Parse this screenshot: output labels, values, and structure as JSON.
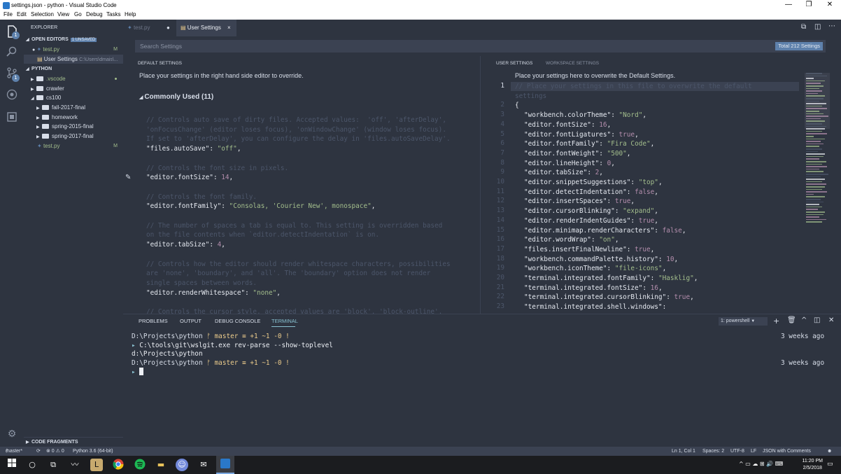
{
  "window": {
    "title": "settings.json - python - Visual Studio Code",
    "minimize": "—",
    "maximize": "❐",
    "close": "✕"
  },
  "menu": [
    "File",
    "Edit",
    "Selection",
    "View",
    "Go",
    "Debug",
    "Tasks",
    "Help"
  ],
  "activity": {
    "explorer_badge": "1",
    "scm_badge": "1"
  },
  "sidebar": {
    "title": "EXPLORER",
    "open_editors": {
      "label": "OPEN EDITORS",
      "unsaved": "1 UNSAVED",
      "items": [
        {
          "name": "test.py",
          "status": "M"
        },
        {
          "name": "User Settings",
          "path": "C:\\Users\\dmais\\..."
        }
      ]
    },
    "folder": "PYTHON",
    "tree": [
      ".vscode",
      "crawler",
      "cs100",
      "fall-2017-final",
      "homework",
      "spring-2015-final",
      "spring-2017-final",
      "test.py"
    ],
    "test_status": "M",
    "code_fragments": "CODE FRAGMENTS"
  },
  "tabs": [
    {
      "label": "test.py",
      "mark": "●"
    },
    {
      "label": "User Settings",
      "mark": "×"
    }
  ],
  "search": {
    "placeholder": "Search Settings",
    "total": "Total 212 Settings"
  },
  "default_settings": {
    "header": "DEFAULT SETTINGS",
    "hint": "Place your settings in the right hand side editor to override.",
    "section": "Commonly Used (11)",
    "blocks": [
      {
        "comments": [
          "// Controls auto save of dirty files. Accepted values:  'off', 'afterDelay',",
          "'onFocusChange' (editor loses focus), 'onWindowChange' (window loses focus).",
          "If set to 'afterDelay', you can configure the delay in 'files.autoSaveDelay'."
        ],
        "key": "\"files.autoSave\"",
        "value": "\"off\"",
        "vtype": "str"
      },
      {
        "comments": [
          "// Controls the font size in pixels."
        ],
        "key": "\"editor.fontSize\"",
        "value": "14",
        "vtype": "num"
      },
      {
        "comments": [
          "// Controls the font family."
        ],
        "key": "\"editor.fontFamily\"",
        "value": "\"Consolas, 'Courier New', monospace\"",
        "vtype": "str"
      },
      {
        "comments": [
          "// The number of spaces a tab is equal to. This setting is overridden based",
          "on the file contents when `editor.detectIndentation` is on."
        ],
        "key": "\"editor.tabSize\"",
        "value": "4",
        "vtype": "num"
      },
      {
        "comments": [
          "// Controls how the editor should render whitespace characters, possibilities",
          "are 'none', 'boundary', and 'all'. The 'boundary' option does not render",
          "single spaces between words."
        ],
        "key": "\"editor.renderWhitespace\"",
        "value": "\"none\"",
        "vtype": "str"
      },
      {
        "comments": [
          "// Controls the cursor style, accepted values are 'block', 'block-outline',"
        ],
        "key": "",
        "value": "",
        "vtype": "str"
      }
    ]
  },
  "user_settings": {
    "tabs": [
      "USER SETTINGS",
      "WORKSPACE SETTINGS"
    ],
    "hint": "Place your settings here to overwrite the Default Settings.",
    "lines": [
      {
        "n": "1",
        "kind": "comment",
        "text": "// Place your settings in this file to overwrite the default"
      },
      {
        "n": "",
        "kind": "comment",
        "text": "settings"
      },
      {
        "n": "2",
        "kind": "brace",
        "text": "{"
      },
      {
        "n": "3",
        "kind": "kv",
        "key": "\"workbench.colorTheme\"",
        "value": "\"Nord\"",
        "vtype": "str"
      },
      {
        "n": "4",
        "kind": "kv",
        "key": "\"editor.fontSize\"",
        "value": "16",
        "vtype": "num"
      },
      {
        "n": "5",
        "kind": "kv",
        "key": "\"editor.fontLigatures\"",
        "value": "true",
        "vtype": "num"
      },
      {
        "n": "6",
        "kind": "kv",
        "key": "\"editor.fontFamily\"",
        "value": "\"Fira Code\"",
        "vtype": "str"
      },
      {
        "n": "7",
        "kind": "kv",
        "key": "\"editor.fontWeight\"",
        "value": "\"500\"",
        "vtype": "str"
      },
      {
        "n": "8",
        "kind": "kv",
        "key": "\"editor.lineHeight\"",
        "value": "0",
        "vtype": "num"
      },
      {
        "n": "9",
        "kind": "kv",
        "key": "\"editor.tabSize\"",
        "value": "2",
        "vtype": "num"
      },
      {
        "n": "10",
        "kind": "kv",
        "key": "\"editor.snippetSuggestions\"",
        "value": "\"top\"",
        "vtype": "str"
      },
      {
        "n": "11",
        "kind": "kv",
        "key": "\"editor.detectIndentation\"",
        "value": "false",
        "vtype": "num"
      },
      {
        "n": "12",
        "kind": "kv",
        "key": "\"editor.insertSpaces\"",
        "value": "true",
        "vtype": "num"
      },
      {
        "n": "13",
        "kind": "kv",
        "key": "\"editor.cursorBlinking\"",
        "value": "\"expand\"",
        "vtype": "str"
      },
      {
        "n": "14",
        "kind": "kv",
        "key": "\"editor.renderIndentGuides\"",
        "value": "true",
        "vtype": "num"
      },
      {
        "n": "15",
        "kind": "kv",
        "key": "\"editor.minimap.renderCharacters\"",
        "value": "false",
        "vtype": "num"
      },
      {
        "n": "16",
        "kind": "kv",
        "key": "\"editor.wordWrap\"",
        "value": "\"on\"",
        "vtype": "str"
      },
      {
        "n": "17",
        "kind": "kv",
        "key": "\"files.insertFinalNewline\"",
        "value": "true",
        "vtype": "num"
      },
      {
        "n": "18",
        "kind": "kv",
        "key": "\"workbench.commandPalette.history\"",
        "value": "10",
        "vtype": "num"
      },
      {
        "n": "19",
        "kind": "kv",
        "key": "\"workbench.iconTheme\"",
        "value": "\"file-icons\"",
        "vtype": "str"
      },
      {
        "n": "20",
        "kind": "kv",
        "key": "\"terminal.integrated.fontFamily\"",
        "value": "\"Hasklig\"",
        "vtype": "str"
      },
      {
        "n": "21",
        "kind": "kv",
        "key": "\"terminal.integrated.fontSize\"",
        "value": "16",
        "vtype": "num"
      },
      {
        "n": "22",
        "kind": "kv",
        "key": "\"terminal.integrated.cursorBlinking\"",
        "value": "true",
        "vtype": "num"
      },
      {
        "n": "23",
        "kind": "obj",
        "key": "\"terminal.integrated.shell.windows\"",
        "value": "",
        "vtype": "str"
      }
    ]
  },
  "panel": {
    "tabs": [
      "PROBLEMS",
      "OUTPUT",
      "DEBUG CONSOLE",
      "TERMINAL"
    ],
    "shell": "1: powershell",
    "terminal": [
      {
        "path": "D:\\Projects\\python",
        "branch": "master",
        "status": "≡ +1 ~1 -0 !",
        "time": "3 weeks ago"
      },
      {
        "cmd": "C:\\tools\\git\\wslgit.exe rev-parse --show-toplevel"
      },
      {
        "out": "d:\\Projects\\python"
      },
      {
        "path": "D:\\Projects\\python",
        "branch": "master",
        "status": "≡ +1 ~1 -0 !",
        "time": "3 weeks ago"
      }
    ]
  },
  "status": {
    "branch": "master*",
    "sync": "⟳",
    "problems": "⊗ 0 ⚠ 0",
    "python": "Python 3.6 (64-bit)",
    "position": "Ln 1, Col 1",
    "spaces": "Spaces: 2",
    "encoding": "UTF-8",
    "eol": "LF",
    "language": "JSON with Comments",
    "feedback": "☻"
  },
  "taskbar": {
    "time": "11:20 PM",
    "date": "2/5/2018"
  },
  "colors": {
    "bg": "#2e3440",
    "accent": "#88c0d0",
    "badge": "#5e81ac",
    "string": "#a3be8c",
    "number": "#b48ead",
    "comment": "#4c566a"
  }
}
